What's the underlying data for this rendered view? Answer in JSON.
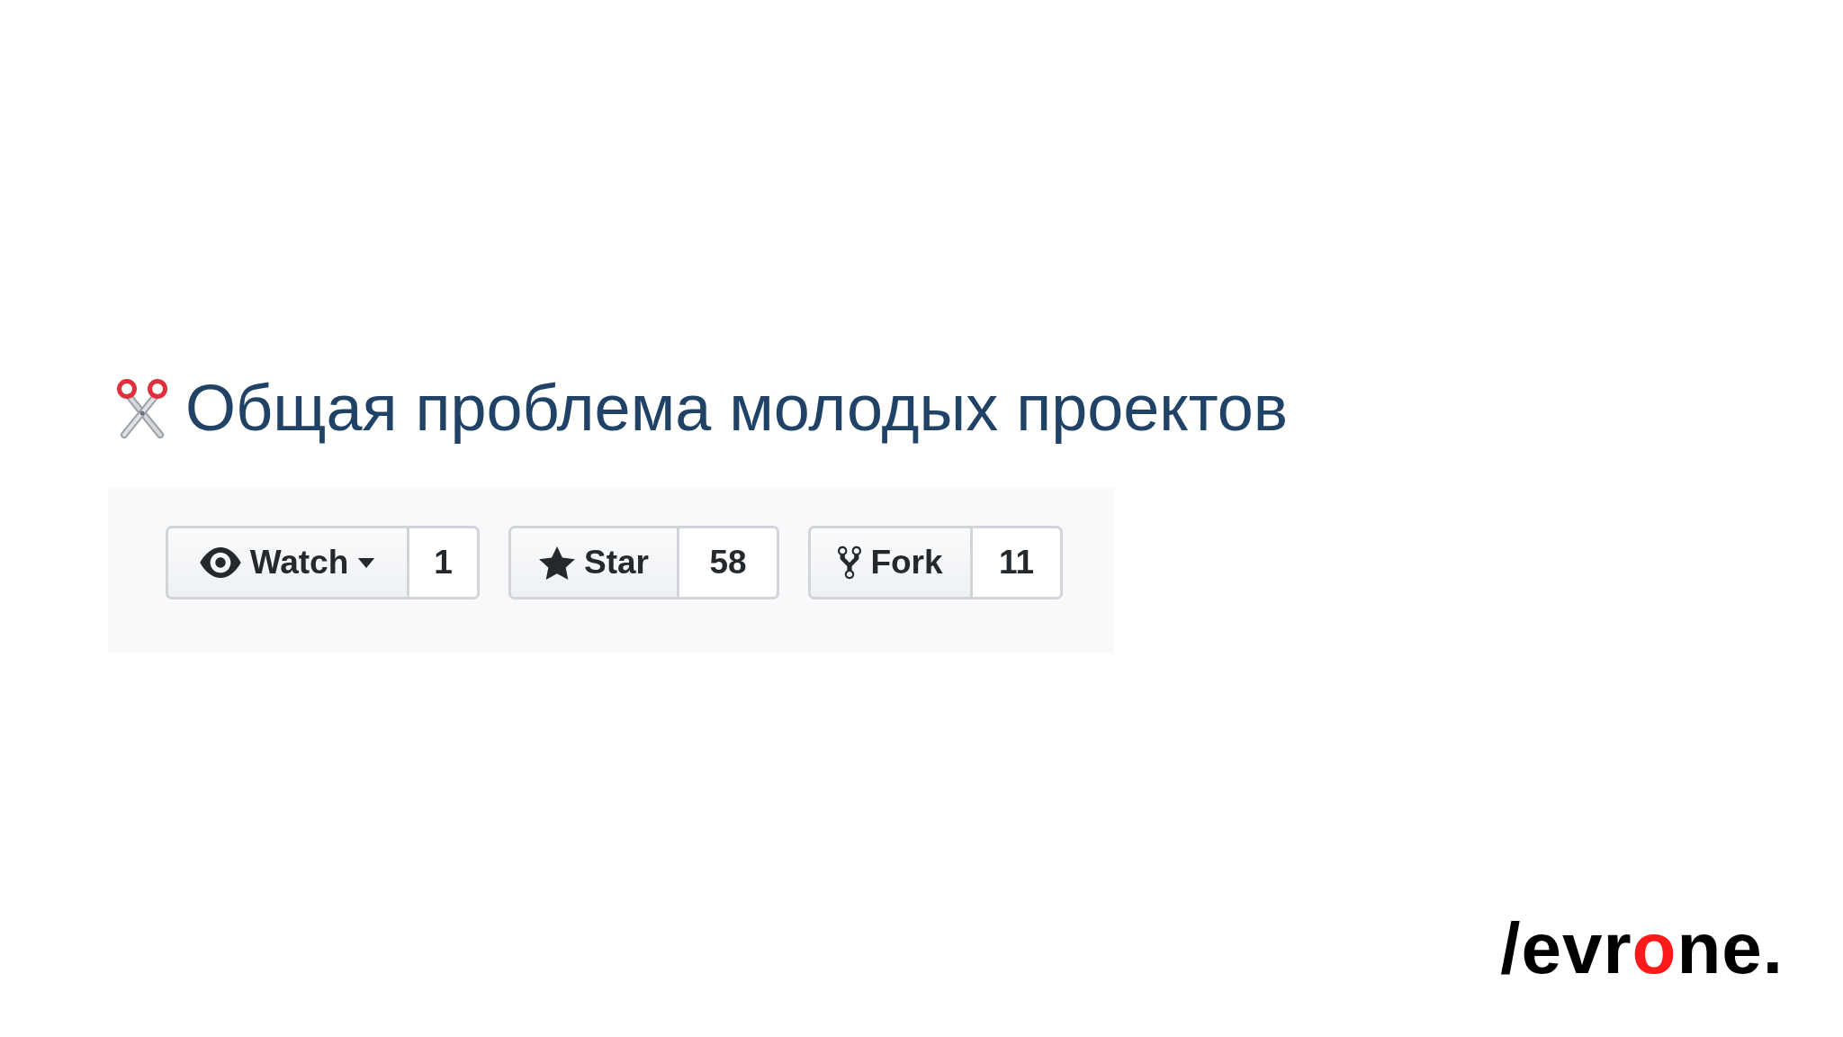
{
  "title": "Общая проблема молодых проектов",
  "repo_buttons": [
    {
      "kind": "watch",
      "label": "Watch",
      "dropdown": true,
      "count": "1"
    },
    {
      "kind": "star",
      "label": "Star",
      "dropdown": false,
      "count": "58"
    },
    {
      "kind": "fork",
      "label": "Fork",
      "dropdown": false,
      "count": "11"
    }
  ],
  "logo": {
    "prefix": "/evr",
    "accent": "o",
    "suffix": "ne."
  }
}
